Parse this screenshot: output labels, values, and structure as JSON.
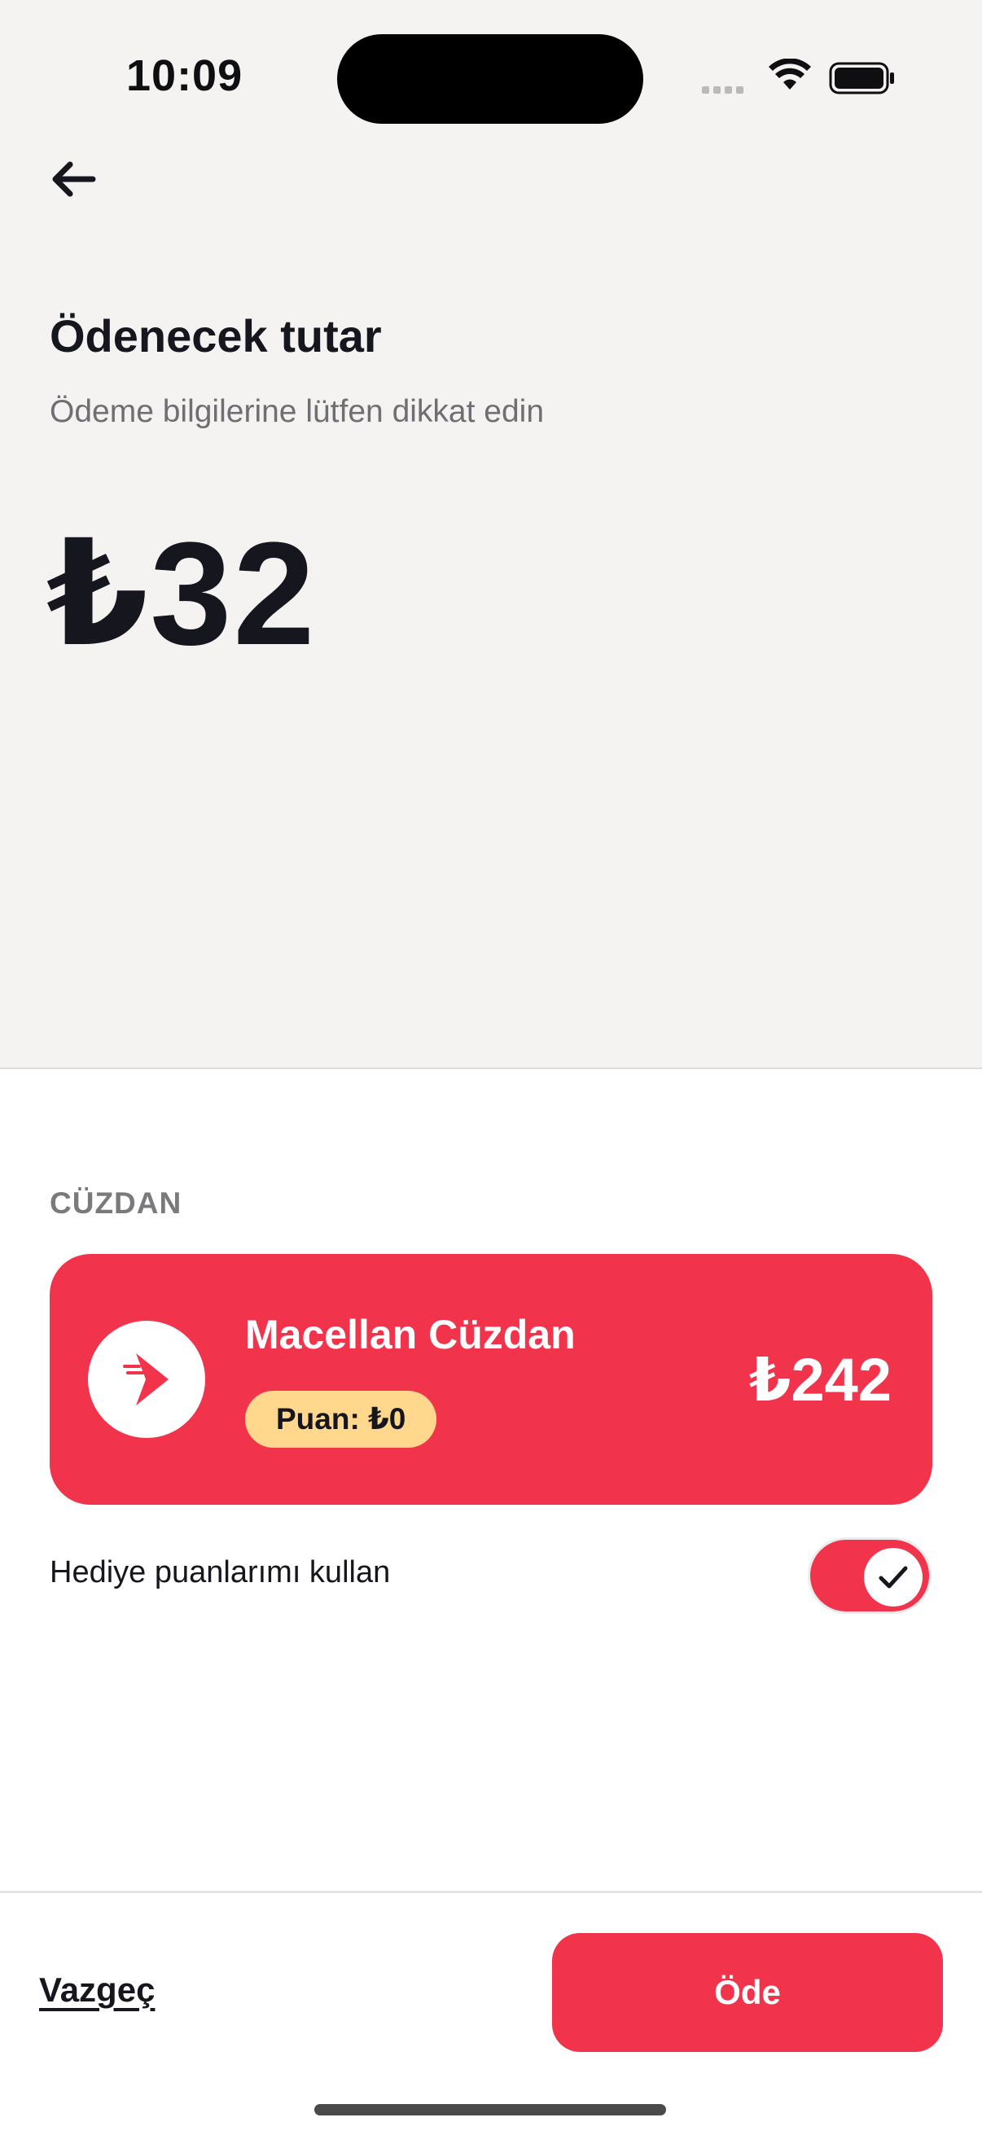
{
  "status_bar": {
    "time": "10:09"
  },
  "header": {
    "back_icon": "arrow-left-icon",
    "title": "Ödenecek tutar",
    "subtitle": "Ödeme bilgilerine lütfen dikkat edin",
    "amount": "₺32"
  },
  "wallet": {
    "section_label": "CÜZDAN",
    "name": "Macellan Cüzdan",
    "points_badge": "Puan: ₺0",
    "balance": "₺242",
    "logo_icon": "macellan-logo-icon",
    "card_color": "#f1344c",
    "badge_color": "#ffd88e"
  },
  "gift_points": {
    "label": "Hediye puanlarımı kullan",
    "enabled": true
  },
  "footer": {
    "cancel_label": "Vazgeç",
    "pay_label": "Öde"
  },
  "colors": {
    "accent": "#f1344c",
    "top_background": "#f4f3f1",
    "text_primary": "#16161e",
    "text_secondary": "#6f6e72"
  }
}
